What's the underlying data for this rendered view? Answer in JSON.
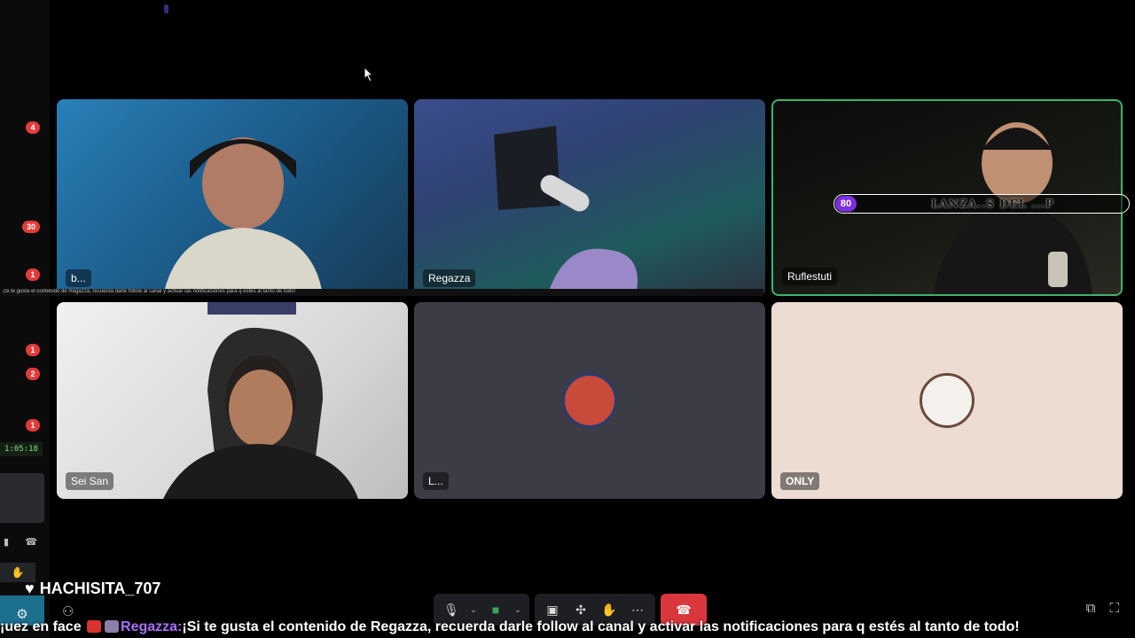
{
  "sidebar": {
    "badges": [
      "4",
      "30",
      "1",
      "1",
      "2",
      "1"
    ],
    "call_timer": "1:05:18"
  },
  "tiles": [
    {
      "name": "b...",
      "type": "video"
    },
    {
      "name": "Regazza",
      "type": "video"
    },
    {
      "name": "Ruflestuti",
      "type": "video",
      "speaking": true
    },
    {
      "name": "Sei San",
      "type": "video"
    },
    {
      "name": "L...",
      "type": "avatar"
    },
    {
      "name": "ONLY",
      "type": "avatar"
    }
  ],
  "stream_banner": {
    "number": "80",
    "text": "LANZA..S DEL ...P"
  },
  "overlay_strip_text": "¡Si te gusta el contenido de Regazza, recuerda darle follow al canal y activar las notificaciones para q estés al tanto de todo!",
  "follower_alert": {
    "name": "HACHISITA_707",
    "icon": "heart-icon"
  },
  "controls": {
    "mic": "microphone-icon",
    "camera": "camera-icon",
    "share": "screen-share-icon",
    "activities": "activities-icon",
    "soundboard": "soundboard-icon",
    "more": "more-icon",
    "disconnect": "hang-up-icon"
  },
  "ticker": {
    "prefix": "¡uez en face",
    "user": "Regazza:",
    "message": "¡Si te gusta el contenido de Regazza, recuerda darle follow al canal y activar las notificaciones para q estés al tanto de todo!"
  },
  "colors": {
    "speaking_border": "#3fb26a",
    "hangup": "#da373c",
    "badge": "#e23b3b",
    "ticker_user": "#a970ff"
  }
}
